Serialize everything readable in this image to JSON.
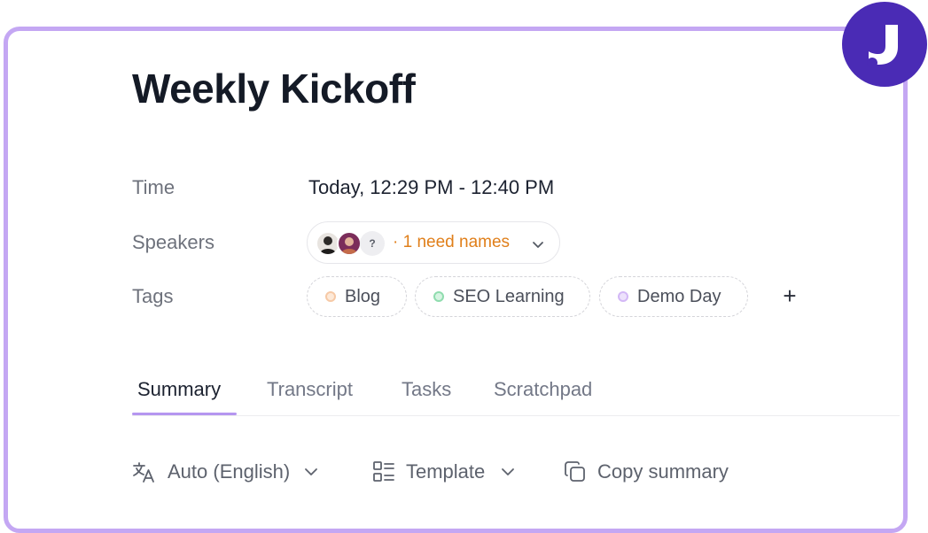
{
  "meeting": {
    "title": "Weekly Kickoff"
  },
  "details": {
    "time_label": "Time",
    "time_value": "Today, 12:29 PM - 12:40 PM",
    "speakers_label": "Speakers",
    "unknown_speaker_symbol": "?",
    "need_names_text": "· 1 need names",
    "tags_label": "Tags",
    "tags": [
      {
        "name": "Blog",
        "color": "#f6c9a6"
      },
      {
        "name": "SEO Learning",
        "color": "#8fdcae"
      },
      {
        "name": "Demo Day",
        "color": "#d3b8f6"
      }
    ],
    "add_tag_symbol": "+"
  },
  "tabs": [
    {
      "label": "Summary",
      "active": true
    },
    {
      "label": "Transcript",
      "active": false
    },
    {
      "label": "Tasks",
      "active": false
    },
    {
      "label": "Scratchpad",
      "active": false
    }
  ],
  "toolbar": {
    "language_label": "Auto (English)",
    "template_label": "Template",
    "copy_label": "Copy summary"
  },
  "colors": {
    "frame_border": "#c4a7f3",
    "logo_bg": "#4a2bb5",
    "need_names": "#e07f1a",
    "active_tab_underline": "#b596f0"
  },
  "icons": {
    "logo": "brand-j-logo",
    "speakers_dropdown": "chevron-down-icon",
    "language": "translate-icon",
    "template": "template-icon",
    "copy": "copy-icon"
  }
}
